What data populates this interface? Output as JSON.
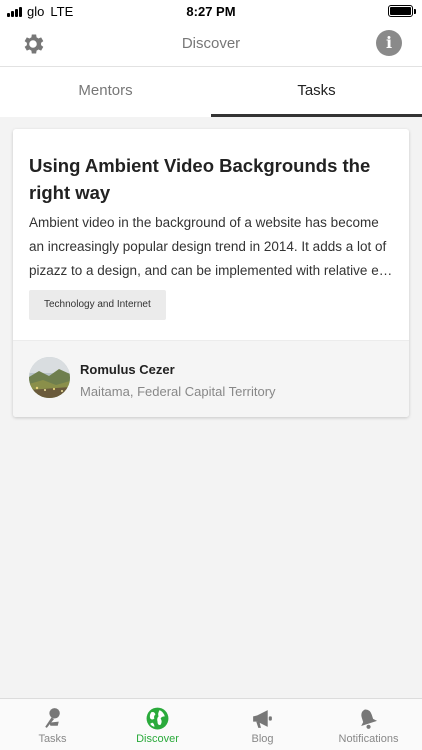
{
  "status": {
    "carrier": "glo",
    "network": "LTE",
    "time": "8:27 PM"
  },
  "nav": {
    "title": "Discover",
    "left_icon": "gear-icon",
    "right_icon": "info-icon",
    "info_glyph": "i"
  },
  "tabs": [
    {
      "label": "Mentors",
      "active": false
    },
    {
      "label": "Tasks",
      "active": true
    }
  ],
  "task": {
    "title": "Using Ambient Video Backgrounds the right way",
    "description_lines": [
      "Ambient video in the background of a website has become",
      "an increasingly popular design trend in 2014. It adds a lot of",
      "pizazz to a design, and can be implemented with relative ea..."
    ],
    "tag": "Technology and Internet",
    "author": {
      "name": "Romulus Cezer",
      "location": "Maitama, Federal Capital Territory"
    }
  },
  "bottom_tabs": [
    {
      "label": "Tasks",
      "icon": "pin-icon",
      "active": false
    },
    {
      "label": "Discover",
      "icon": "globe-icon",
      "active": true
    },
    {
      "label": "Blog",
      "icon": "megaphone-icon",
      "active": false
    },
    {
      "label": "Notifications",
      "icon": "bell-icon",
      "active": false
    }
  ],
  "colors": {
    "accent": "#2aaa3b",
    "inactive": "#888888",
    "background": "#f3f3f3"
  }
}
